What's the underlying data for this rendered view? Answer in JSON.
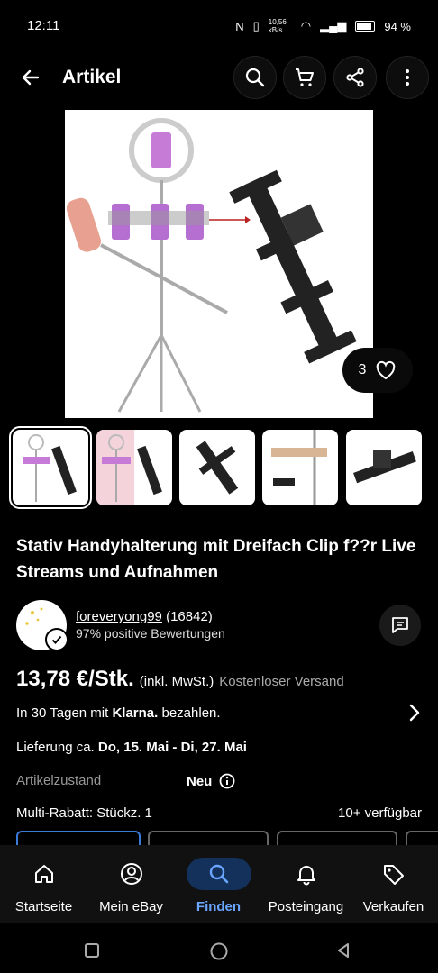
{
  "status_bar": {
    "time": "12:11",
    "net_speed": "10,56 kB/s",
    "battery": "94 %"
  },
  "header": {
    "title": "Artikel",
    "icons": [
      "back-arrow-icon",
      "search-icon",
      "cart-icon",
      "share-icon",
      "more-vertical-icon"
    ]
  },
  "gallery": {
    "like_count": "3",
    "thumb_count": 5,
    "selected_thumb": 0
  },
  "product": {
    "title": "Stativ Handyhalterung mit Dreifach Clip f??r Live Streams und Aufnahmen",
    "seller_name": "foreveryong99",
    "seller_count": "(16842)",
    "seller_rating": "97% positive Bewertungen",
    "price": "13,78 €/Stk.",
    "tax_note": "(inkl. MwSt.)",
    "shipping": "Kostenloser Versand",
    "klarna_prefix": "In 30 Tagen mit",
    "klarna_brand": "Klarna.",
    "klarna_suffix": "bezahlen.",
    "delivery_prefix": "Lieferung ca.",
    "delivery_dates": "Do, 15. Mai - Di, 27. Mai",
    "condition_label": "Artikelzustand",
    "condition_value": "Neu",
    "multi_discount": "Multi-Rabatt: Stückz. 1",
    "availability": "10+ verfügbar"
  },
  "colors": {
    "background": "#000000",
    "accent_blue": "#6aa6ff",
    "active_pill": "#13315a"
  },
  "bottom_nav": {
    "items": [
      {
        "label": "Startseite",
        "icon": "home-icon"
      },
      {
        "label": "Mein eBay",
        "icon": "profile-icon"
      },
      {
        "label": "Finden",
        "icon": "search-icon",
        "active": true
      },
      {
        "label": "Posteingang",
        "icon": "bell-icon"
      },
      {
        "label": "Verkaufen",
        "icon": "tag-icon"
      }
    ]
  }
}
